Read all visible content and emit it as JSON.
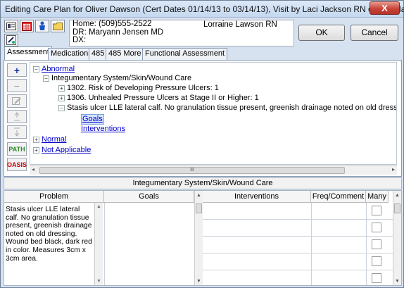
{
  "window": {
    "title": "Editing Care Plan for Oliver Dawson (Cert Dates 01/14/13 to 03/14/13), Visit by Laci Jackson RN on Monday ...",
    "close_glyph": "X"
  },
  "patient": {
    "home": "Home:  (509)555-2522",
    "dr": "DR:  Maryann Jensen MD",
    "dx": "DX:",
    "nurse": "Lorraine Lawson RN"
  },
  "buttons": {
    "ok": "OK",
    "cancel": "Cancel"
  },
  "tabs": [
    "Assessment",
    "Medications",
    "485",
    "485 More",
    "Functional Assessment"
  ],
  "toolbar": {
    "add": "+",
    "remove": "−",
    "path": "PATH",
    "oasis": "OASIS"
  },
  "tree": {
    "abnormal": "Abnormal",
    "integumentary": "Integumentary System/Skin/Wound Care",
    "item1302": "1302. Risk of Developing Pressure Ulcers: 1",
    "item1306": "1306. Unhealed Pressure Ulcers at Stage II or Higher: 1",
    "stasis": "Stasis ulcer LLE lateral calf. No granulation tissue present, greenish drainage noted on old dressing. Wound be",
    "goals": "Goals",
    "interventions": "Interventions",
    "normal": "Normal",
    "not_applicable": "Not Applicable",
    "scroll_grip": "III",
    "expand": "+",
    "collapse": "−"
  },
  "section_title": "Integumentary System/Skin/Wound Care",
  "grid": {
    "columns": [
      "Problem",
      "Goals",
      "Interventions",
      "Freq/Comment",
      "Many"
    ],
    "problem_text": "Stasis ulcer LLE lateral calf. No granulation tissue present, greenish drainage noted on old dressing. Wound bed black, dark red in color. Measures 3cm x 3cm area."
  }
}
